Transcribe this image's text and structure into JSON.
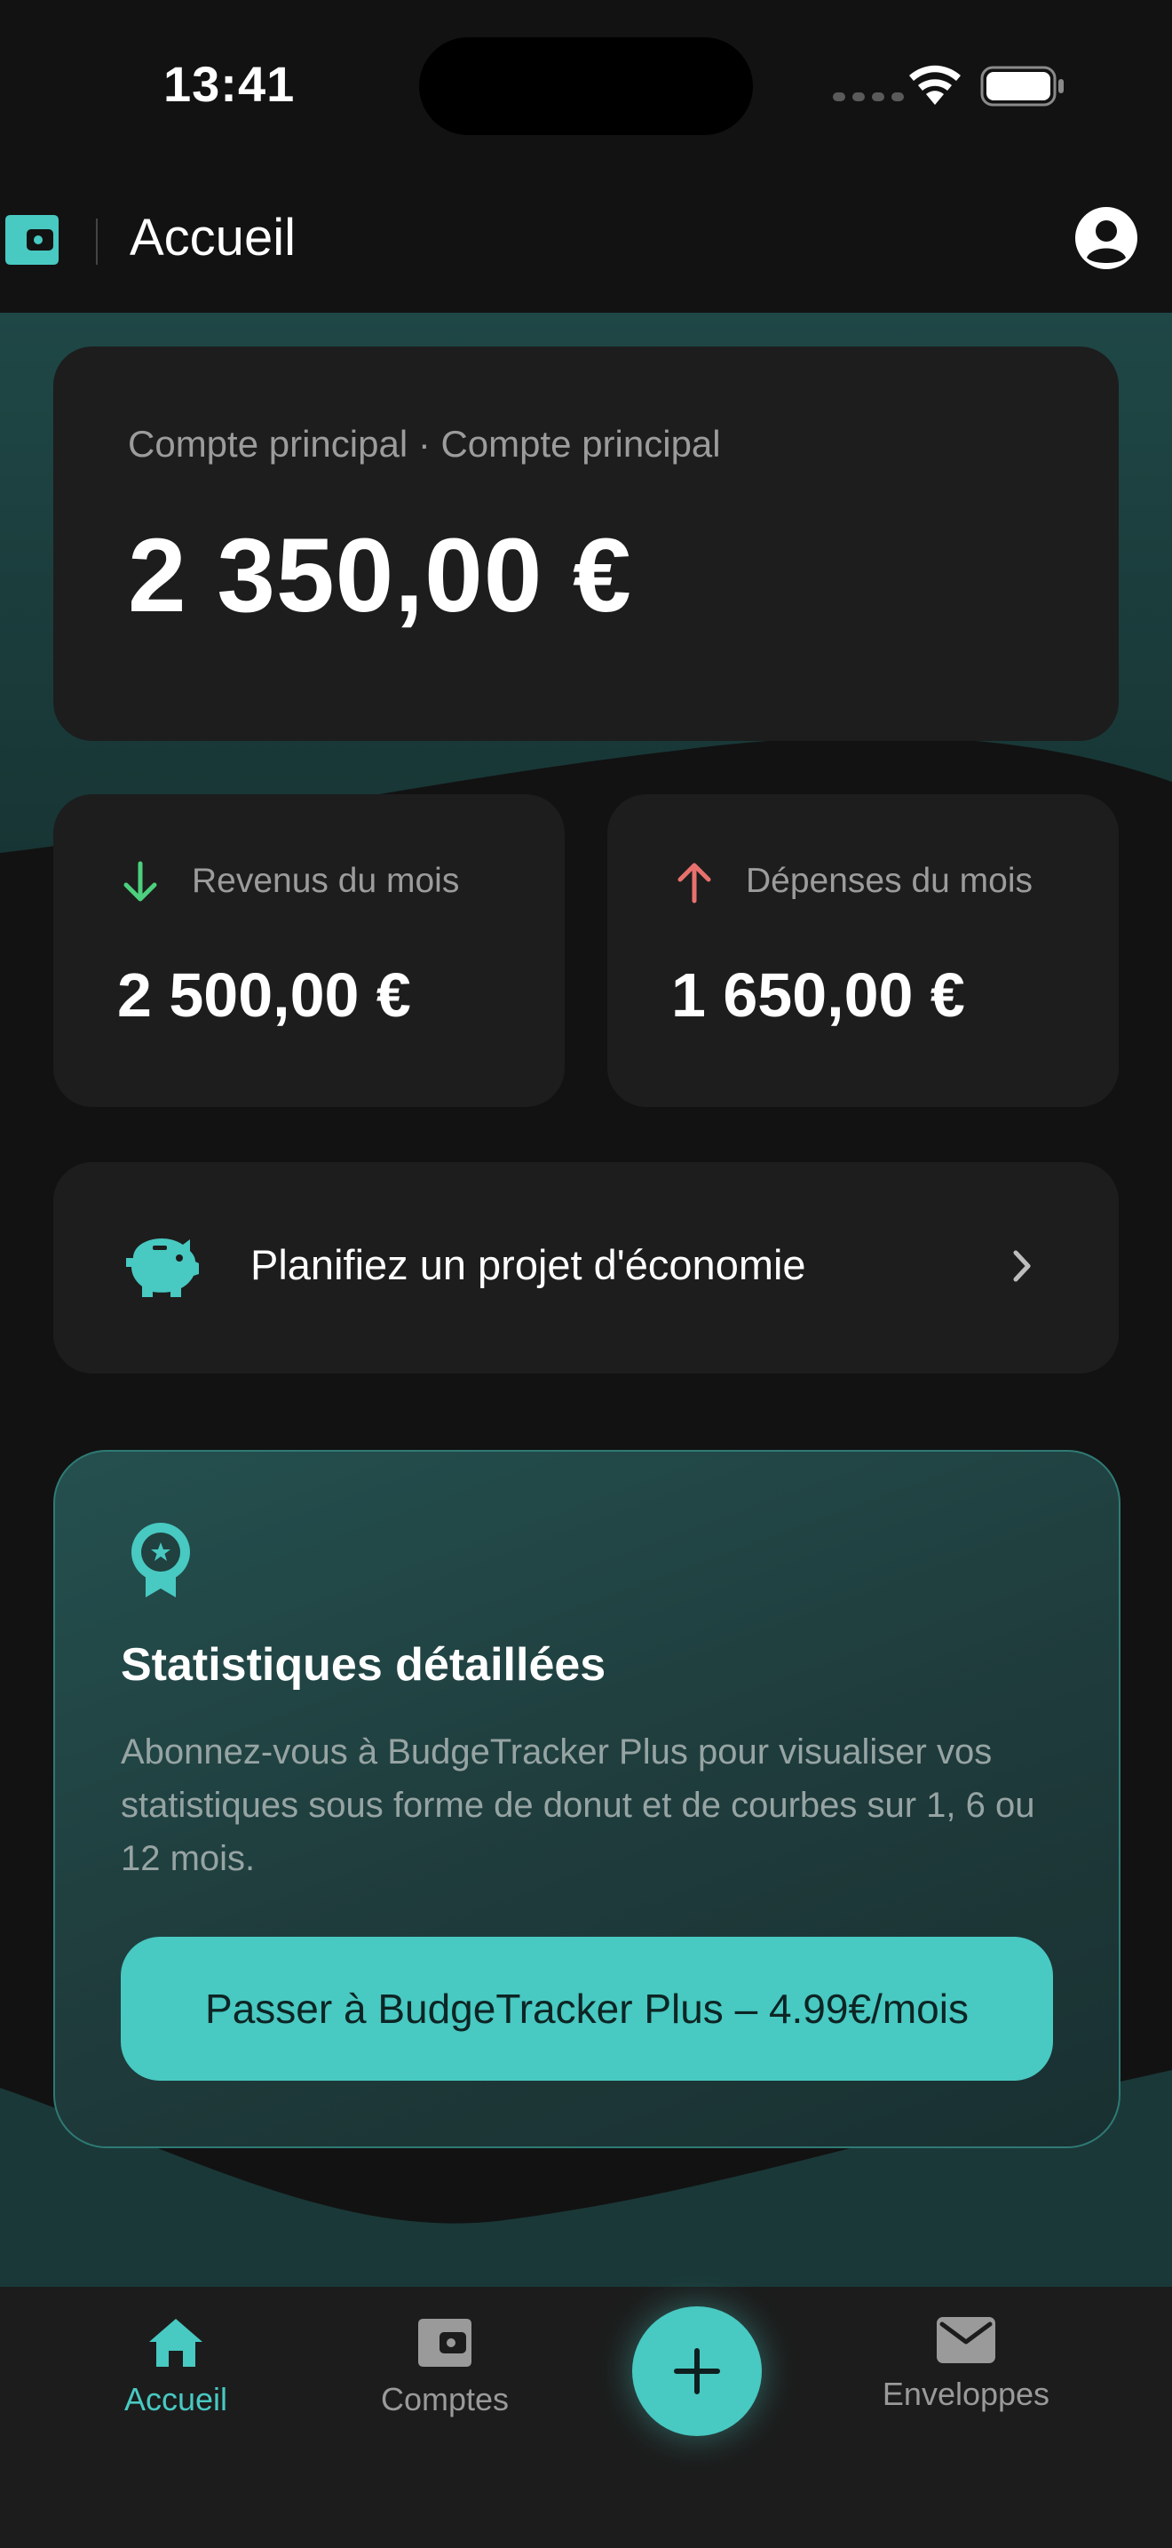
{
  "status_bar": {
    "time": "13:41"
  },
  "header": {
    "title": "Accueil",
    "logo_icon": "wallet-icon",
    "profile_icon": "user-circle-icon"
  },
  "balance": {
    "account_label": "Compte principal · Compte principal",
    "amount": "2 350,00 €"
  },
  "income": {
    "label": "Revenus du mois",
    "amount": "2 500,00 €",
    "icon": "arrow-down-icon",
    "color": "#4cd07d"
  },
  "expenses": {
    "label": "Dépenses du mois",
    "amount": "1 650,00 €",
    "icon": "arrow-up-icon",
    "color": "#e8716d"
  },
  "savings": {
    "label": "Planifiez un projet d'économie",
    "icon": "piggy-bank-icon"
  },
  "promo": {
    "title": "Statistiques détaillées",
    "description": "Abonnez-vous à BudgeTracker Plus pour visualiser vos statistiques sous forme de donut et de courbes sur 1, 6 ou 12 mois.",
    "button_label": "Passer à BudgeTracker Plus – 4.99€/mois",
    "icon": "award-medal-icon"
  },
  "bottom_nav": {
    "items": [
      {
        "label": "Accueil",
        "icon": "home-icon",
        "active": true
      },
      {
        "label": "Comptes",
        "icon": "wallet-icon",
        "active": false
      },
      {
        "label": "Enveloppes",
        "icon": "envelope-icon",
        "active": false
      }
    ],
    "fab_icon": "plus-icon"
  },
  "colors": {
    "accent": "#48c9c2",
    "background": "#121212",
    "card": "#1d1d1d"
  }
}
